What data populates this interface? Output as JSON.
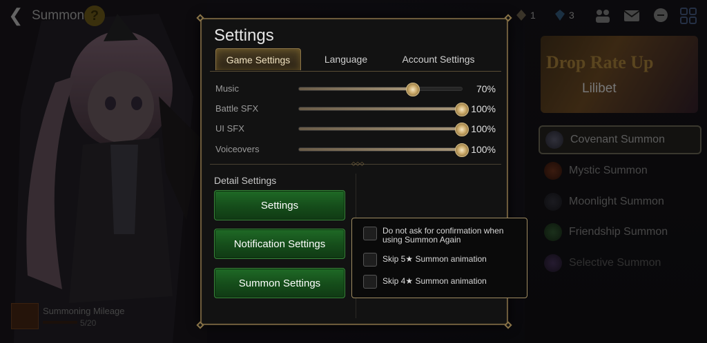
{
  "header": {
    "title": "Summon",
    "back_icon": "back-arrow-icon",
    "help_icon": "help-icon"
  },
  "resources": [
    {
      "icon": "bookmark-icon",
      "value": "1"
    },
    {
      "icon": "crystal-icon",
      "value": "3"
    }
  ],
  "top_icons": [
    "friends-icon",
    "mail-icon",
    "chat-icon",
    "menu-grid-icon"
  ],
  "banner": {
    "title": "Drop Rate Up",
    "name": "Lilibet"
  },
  "summon_list": [
    {
      "label": "Covenant Summon",
      "icon": "covenant-icon",
      "active": true
    },
    {
      "label": "Mystic Summon",
      "icon": "mystic-icon",
      "active": false
    },
    {
      "label": "Moonlight Summon",
      "icon": "moonlight-icon",
      "active": false
    },
    {
      "label": "Friendship Summon",
      "icon": "friendship-icon",
      "active": false
    },
    {
      "label": "Selective Summon",
      "icon": "selective-icon",
      "active": false
    }
  ],
  "mileage": {
    "label": "Summoning Mileage",
    "value": "5/20"
  },
  "settings": {
    "title": "Settings",
    "tabs": [
      {
        "label": "Game Settings",
        "active": true
      },
      {
        "label": "Language",
        "active": false
      },
      {
        "label": "Account Settings",
        "active": false
      }
    ],
    "sliders": [
      {
        "label": "Music",
        "value": "70%",
        "level": 0.7
      },
      {
        "label": "Battle SFX",
        "value": "100%",
        "level": 1.0
      },
      {
        "label": "UI SFX",
        "value": "100%",
        "level": 1.0
      },
      {
        "label": "Voiceovers",
        "value": "100%",
        "level": 1.0
      }
    ],
    "detail_label": "Detail Settings",
    "buttons": [
      {
        "label": "Settings"
      },
      {
        "label": "Notification Settings"
      },
      {
        "label": "Summon Settings"
      }
    ]
  },
  "summon_options": [
    {
      "label": "Do not ask for confirmation when using Summon Again",
      "checked": false
    },
    {
      "label": "Skip 5★ Summon animation",
      "checked": false
    },
    {
      "label": "Skip 4★ Summon animation",
      "checked": false
    }
  ],
  "colors": {
    "accent_gold": "#8a7448",
    "button_green": "#1f6a26",
    "panel_bg": "#121212"
  }
}
